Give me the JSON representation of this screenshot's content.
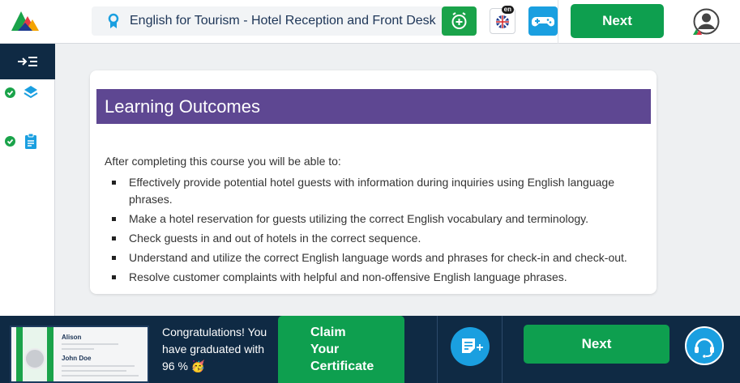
{
  "header": {
    "course_title": "English for Tourism - Hotel Reception and Front Desk",
    "lang_badge": "en",
    "next_label": "Next"
  },
  "sidebar": {
    "items": [
      {
        "icon": "layers-icon",
        "status": "completed"
      },
      {
        "icon": "clipboard-icon",
        "status": "completed"
      }
    ]
  },
  "content": {
    "heading": "Learning Outcomes",
    "intro": "After completing this course you will be able to:",
    "outcomes": [
      "Effectively provide potential hotel guests with information during inquiries using English language phrases.",
      "Make a hotel reservation for guests utilizing the correct English vocabulary and terminology.",
      "Check guests in and out of hotels in the correct sequence.",
      "Understand and utilize the correct English language words and phrases for check-in and check-out.",
      "Resolve customer complaints with helpful and non-offensive English language phrases."
    ]
  },
  "footer": {
    "certificate": {
      "brand": "Alison",
      "name": "John Doe"
    },
    "congrats_line1": "Congratulations! You have graduated with",
    "congrats_score": "96 %",
    "congrats_emoji": "🥳",
    "claim_label": "Claim Your Certificate",
    "next_label": "Next"
  },
  "colors": {
    "navy": "#0f2a44",
    "green": "#0e9f4f",
    "purple": "#5e4792",
    "blue": "#1a9fe0"
  }
}
